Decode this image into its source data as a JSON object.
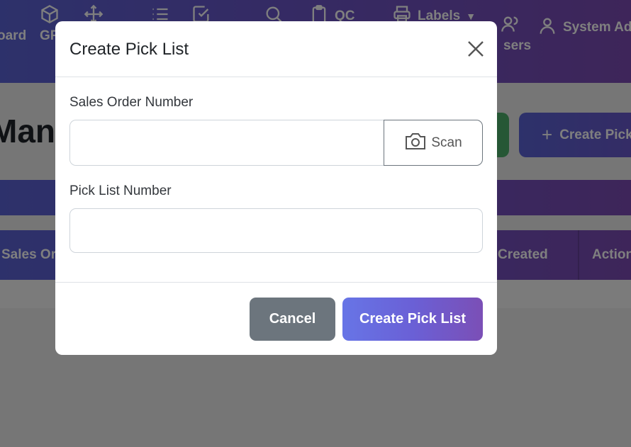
{
  "nav": {
    "dashboard_label": "oard",
    "grn_label": "GR",
    "qc_label": "QC",
    "labels_label": "Labels",
    "users_label": "sers",
    "user_label": "System Ad"
  },
  "page": {
    "title": "Mana",
    "create_button_label": "Create Pick"
  },
  "table": {
    "headers": [
      "Sales Ord",
      "Created",
      "Action"
    ]
  },
  "modal": {
    "title": "Create Pick List",
    "sales_order_label": "Sales Order Number",
    "sales_order_value": "",
    "scan_label": "Scan",
    "pick_list_label": "Pick List Number",
    "pick_list_value": "",
    "cancel_label": "Cancel",
    "submit_label": "Create Pick List"
  }
}
